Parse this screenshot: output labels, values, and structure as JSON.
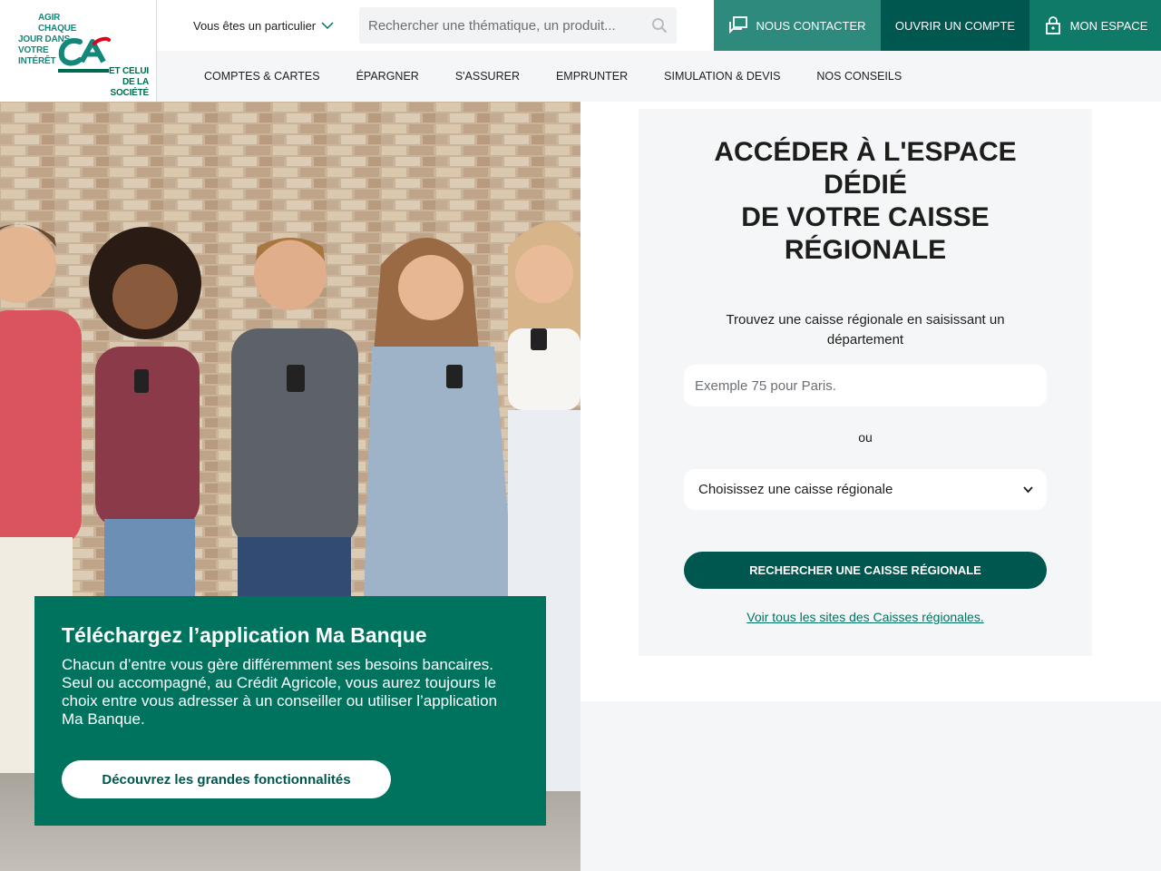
{
  "brand": {
    "tagline_top": [
      "AGIR CHAQUE",
      "JOUR DANS VOTRE",
      "INTÉRÊT"
    ],
    "tagline_bottom": [
      "ET CELUI",
      "DE LA SOCIÉTÉ"
    ],
    "primary_color": "#006a4e",
    "accent_color": "#e2001a"
  },
  "header": {
    "profile_label": "Vous êtes un particulier",
    "search_placeholder": "Rechercher une thématique, un produit...",
    "contact_label": "NOUS CONTACTER",
    "open_account_label": "OUVRIR UN COMPTE",
    "my_space_label": "MON ESPACE"
  },
  "nav": {
    "items": [
      {
        "label": "COMPTES & CARTES"
      },
      {
        "label": "ÉPARGNER"
      },
      {
        "label": "S'ASSURER"
      },
      {
        "label": "EMPRUNTER"
      },
      {
        "label": "SIMULATION & DEVIS"
      },
      {
        "label": "NOS CONSEILS"
      }
    ]
  },
  "promo": {
    "title": "Téléchargez l’application Ma Banque",
    "text_1": "Chacun d’entre vous gère différemment ses besoins bancaires.",
    "text_2": "Seul ou accompagné, au Crédit Agricole, vous aurez toujours le choix entre vous adresser à un conseiller ou utiliser l’application Ma Banque.",
    "cta_label": "Découvrez les grandes fonctionnalités"
  },
  "form": {
    "title_lines": [
      "ACCÉDER À L'ESPACE",
      "DÉDIÉ",
      "DE VOTRE CAISSE",
      "RÉGIONALE"
    ],
    "hint": "Trouvez une caisse régionale en saisissant un département",
    "dept_placeholder": "Exemple 75 pour Paris.",
    "or_label": "ou",
    "select_value": "Choisissez une caisse régionale",
    "submit_label": "RECHERCHER UNE CAISSE RÉGIONALE",
    "all_sites_link": "Voir tous les sites des Caisses régionales."
  }
}
